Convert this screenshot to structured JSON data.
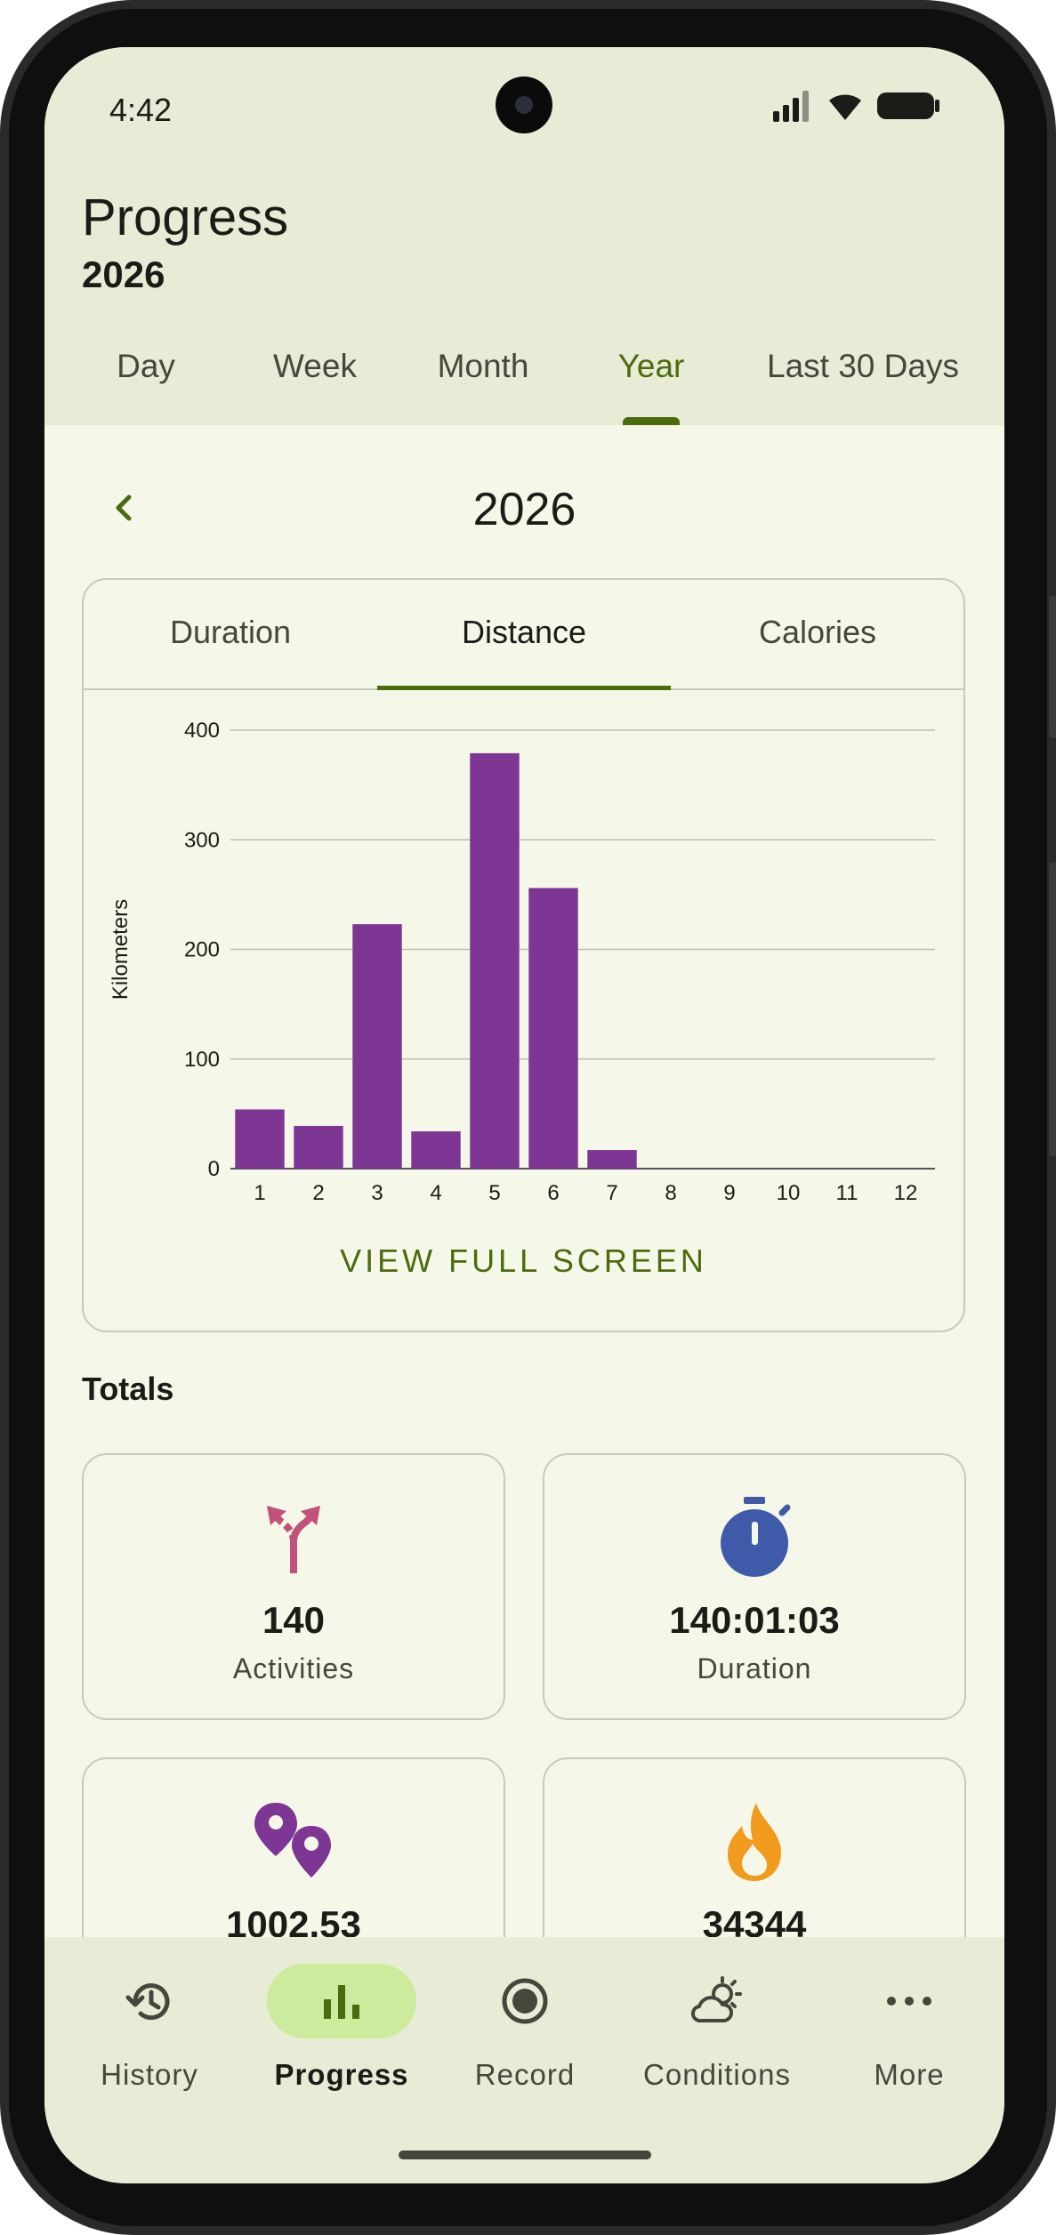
{
  "status": {
    "time": "4:42"
  },
  "header": {
    "title": "Progress",
    "subtitle": "2026"
  },
  "period_tabs": [
    {
      "label": "Day",
      "active": false
    },
    {
      "label": "Week",
      "active": false
    },
    {
      "label": "Month",
      "active": false
    },
    {
      "label": "Year",
      "active": true
    },
    {
      "label": "Last 30 Days",
      "active": false
    }
  ],
  "selector": {
    "year": "2026"
  },
  "chart_tabs": [
    {
      "label": "Duration",
      "active": false
    },
    {
      "label": "Distance",
      "active": true
    },
    {
      "label": "Calories",
      "active": false
    }
  ],
  "chart_data": {
    "type": "bar",
    "categories": [
      "1",
      "2",
      "3",
      "4",
      "5",
      "6",
      "7",
      "8",
      "9",
      "10",
      "11",
      "12"
    ],
    "values": [
      54,
      39,
      223,
      34,
      379,
      256,
      17,
      0,
      0,
      0,
      0,
      0
    ],
    "ylabel": "Kilometers",
    "xlabel": "",
    "ylim": [
      0,
      400
    ],
    "yticks": [
      0,
      100,
      200,
      300,
      400
    ],
    "grid": true,
    "bar_color": "#7e3694"
  },
  "chart_action": {
    "label": "VIEW FULL SCREEN"
  },
  "totals": {
    "label": "Totals",
    "cards": [
      {
        "value": "140",
        "label": "Activities",
        "icon": "split-arrows-icon",
        "color": "#c2527a"
      },
      {
        "value": "140:01:03",
        "label": "Duration",
        "icon": "stopwatch-icon",
        "color": "#3f5aa8"
      },
      {
        "value": "1002.53",
        "label": "",
        "icon": "location-pins-icon",
        "color": "#7e3694"
      },
      {
        "value": "34344",
        "label": "",
        "icon": "flame-icon",
        "color": "#f09a1e"
      }
    ]
  },
  "nav": [
    {
      "label": "History",
      "icon": "history-icon",
      "active": false
    },
    {
      "label": "Progress",
      "icon": "bar-chart-icon",
      "active": true
    },
    {
      "label": "Record",
      "icon": "record-icon",
      "active": false
    },
    {
      "label": "Conditions",
      "icon": "partly-sunny-icon",
      "active": false
    },
    {
      "label": "More",
      "icon": "more-dots-icon",
      "active": false
    }
  ],
  "colors": {
    "accent": "#4c6a0e",
    "surface": "#f5f8e8",
    "topbar": "#e8ecd6",
    "nav_active_pill": "#cdeb9c"
  }
}
